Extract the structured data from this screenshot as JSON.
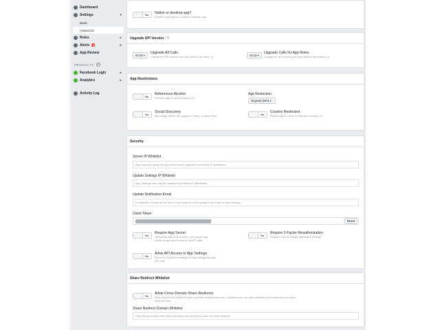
{
  "sidebar": {
    "items": [
      {
        "label": "Dashboard"
      },
      {
        "label": "Settings"
      },
      {
        "label": "Basic"
      },
      {
        "label": "Advanced"
      },
      {
        "label": "Roles"
      },
      {
        "label": "Alerts",
        "badge": "1"
      },
      {
        "label": "App Review"
      },
      {
        "label": "Facebook Login"
      },
      {
        "label": "Analytics"
      },
      {
        "label": "Activity Log"
      }
    ],
    "products_heading": "PRODUCTS",
    "plus_glyph": "+"
  },
  "native": {
    "toggle": "No",
    "title": "Native or desktop app?",
    "desc": "Enable if your app is a native or desktop app"
  },
  "upgrade": {
    "header": "Upgrade API Version",
    "header_hint": "(?)",
    "all_calls": {
      "version": "v2.12 ▾",
      "title": "Upgrade All Calls",
      "desc": "Change the API version your app calls for all users (?)"
    },
    "app_roles": {
      "version": "v2.12 ▾",
      "title": "Upgrade Calls for App Roles",
      "desc": "Change the API version your app calls for developers (?)"
    }
  },
  "restrictions": {
    "header": "App Restrictions",
    "alcohol": {
      "toggle": "No",
      "title": "References Alcohol",
      "desc": "Restricts age in some locations (?)"
    },
    "age": {
      "label": "Age Restriction",
      "value": "Anyone (13+) ▾"
    },
    "social": {
      "toggle": "No",
      "title": "Social Discovery",
      "desc": "App usage stories can appear in Ticker or News Feed"
    },
    "country": {
      "toggle": "No",
      "title": "Country Restricted",
      "desc": "Restrict app to users in selected countries (?)"
    }
  },
  "security": {
    "header": "Security",
    "server_ip": {
      "label": "Server IP Whitelist",
      "placeholder": "App requests using the app secret must originate from these IP addresses."
    },
    "update_ip": {
      "label": "Update Settings IP Whitelist",
      "placeholder": "App Settings can only be updated from these IP addresses."
    },
    "notify": {
      "label": "Update Notification Email",
      "placeholder": "A notification email will be sent to this address when updates are made to app settings"
    },
    "token": {
      "label": "Client Token",
      "reset": "Reset"
    },
    "secret": {
      "toggle": "No",
      "title": "Require App Secret",
      "desc": "Only allow calls from a server and require app secret or app secret proof for all API calls."
    },
    "twofactor": {
      "toggle": "No",
      "title": "Require 2-Factor Reauthorization",
      "desc": "Require 2-fac to change application settings"
    },
    "settings_api": {
      "toggle": "No",
      "title": "Allow API Access to App Settings",
      "desc": "Set to No to prevent changes to app settings through API calls"
    }
  },
  "redirect": {
    "header": "Share Redirect Whitelist",
    "cross": {
      "toggle": "No",
      "title": "Allow Cross Domain Share Redirects",
      "desc": "Allow shares that redirect to your urls from cross domain urls. If disabled you can add a whitelist of domains that you allow redirects from."
    },
    "domain": {
      "label": "Share Redirect Domain Whitelist",
      "placeholder": "Only the optionally white listed domains can redirect to your urls when shared."
    }
  }
}
